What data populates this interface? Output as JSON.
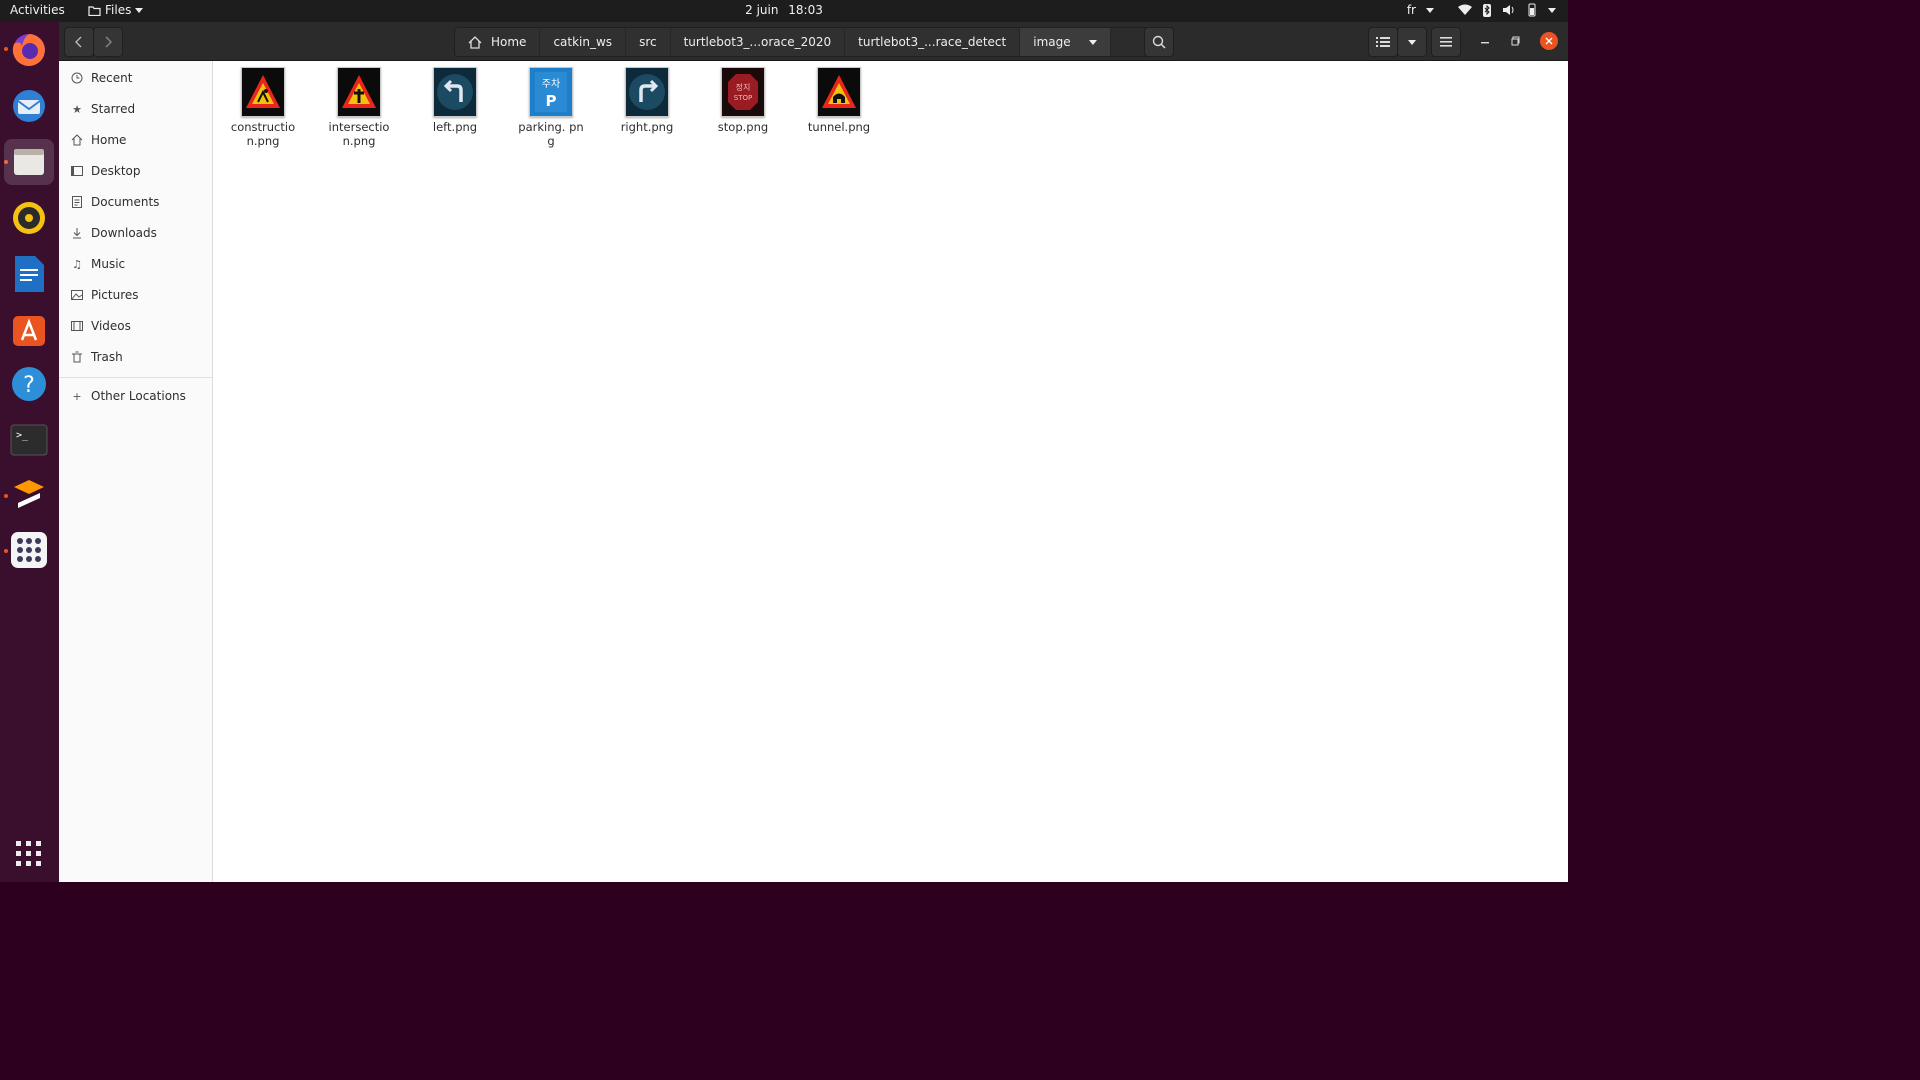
{
  "topbar": {
    "activities": "Activities",
    "app_menu": "Files",
    "date": "2 juin",
    "time": "18:03",
    "language": "fr"
  },
  "dock": {
    "items": [
      "firefox-icon",
      "thunderbird-icon",
      "files-icon",
      "rhythmbox-icon",
      "writer-icon",
      "software-icon",
      "help-icon",
      "terminal-icon",
      "sublime-icon",
      "apps-grid-icon"
    ],
    "show_apps": "show-applications-icon"
  },
  "breadcrumb": [
    "Home",
    "catkin_ws",
    "src",
    "turtlebot3_...orace_2020",
    "turtlebot3_...race_detect",
    "image"
  ],
  "sidebar": {
    "items": [
      {
        "label": "Recent",
        "icon": "clock-icon"
      },
      {
        "label": "Starred",
        "icon": "star-icon"
      },
      {
        "label": "Home",
        "icon": "home-icon"
      },
      {
        "label": "Desktop",
        "icon": "desktop-icon"
      },
      {
        "label": "Documents",
        "icon": "document-icon"
      },
      {
        "label": "Downloads",
        "icon": "download-icon"
      },
      {
        "label": "Music",
        "icon": "music-icon"
      },
      {
        "label": "Pictures",
        "icon": "picture-icon"
      },
      {
        "label": "Videos",
        "icon": "video-icon"
      },
      {
        "label": "Trash",
        "icon": "trash-icon"
      }
    ],
    "other": "Other Locations"
  },
  "files": [
    {
      "name": "constructio n.png",
      "kind": "warning-triangle"
    },
    {
      "name": "intersectio n.png",
      "kind": "warning-triangle"
    },
    {
      "name": "left.png",
      "kind": "blue-circle-left"
    },
    {
      "name": "parking. png",
      "kind": "blue-parking"
    },
    {
      "name": "right.png",
      "kind": "blue-circle-right"
    },
    {
      "name": "stop.png",
      "kind": "stop-octagon"
    },
    {
      "name": "tunnel.png",
      "kind": "warning-triangle"
    }
  ],
  "colors": {
    "accent": "#e95420",
    "close": "#e95420"
  }
}
